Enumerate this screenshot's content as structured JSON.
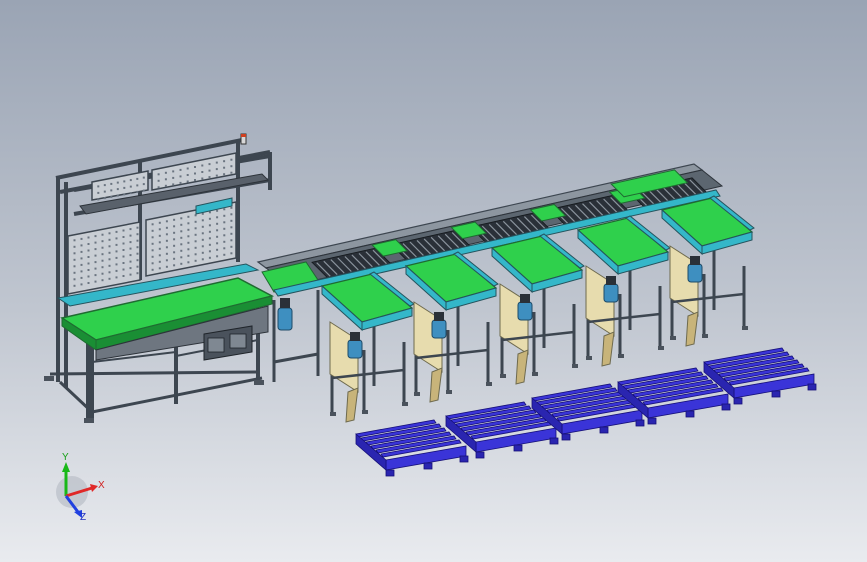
{
  "triad": {
    "x_label": "X",
    "y_label": "Y",
    "z_label": "Z"
  },
  "colors": {
    "background_top": "#9aa4b4",
    "background_bottom": "#e9ebef",
    "frame": "#3d4650",
    "belt_green": "#2fd04c",
    "belt_cyan": "#34b7c9",
    "roller_dark": "#2a3038",
    "motor_blue": "#3e8fc0",
    "panel_beige": "#e7dcae",
    "pallet_blue": "#3a34d8",
    "axis_x": "#e02828",
    "axis_y": "#18b818",
    "axis_z": "#2040e0"
  },
  "objects": {
    "workstation": "conveyor-workstation",
    "main_line": "main-roller-conveyor",
    "branch_count": 5,
    "pallet_count": 5
  }
}
